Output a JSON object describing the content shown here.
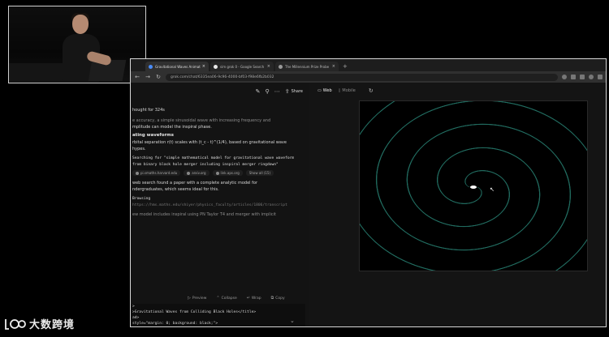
{
  "browser": {
    "tabs": [
      {
        "title": "Gravitational Waves Animatio",
        "active": true
      },
      {
        "title": "sim grok 0 - Google Search",
        "active": false
      },
      {
        "title": "The Millennium Prize Probe",
        "active": false
      }
    ],
    "new_tab": "+",
    "url": "grok.com/chat/6335ea06-9c96-4000-bf03-f98e6fb2b032",
    "nav": {
      "back": "←",
      "forward": "→",
      "reload": "↻"
    }
  },
  "chat": {
    "toolbar": {
      "share_label": "Share"
    },
    "lines": [
      {
        "kind": "bright",
        "text": "hought for 324s"
      },
      {
        "kind": "dim",
        "text": "e accuracy, a simple sinusoidal wave with increasing frequency and"
      },
      {
        "kind": "bright",
        "text": "mplitude can model the inspiral phase."
      },
      {
        "kind": "heading",
        "text": "ating waveforms"
      },
      {
        "kind": "dim",
        "text": "rbital separation r(t) scales with (t_c - t)^(1/4), based on gravitational wave"
      },
      {
        "kind": "dim",
        "text": "hypes."
      },
      {
        "kind": "mono",
        "text": "Searching for \"simple mathematical model for gravitational wave waveform"
      },
      {
        "kind": "mono",
        "text": "from binary black hole merger including inspiral merger ringdown\""
      }
    ],
    "sources": [
      "pi.smaths.harvard.edu",
      "arxiv.org",
      "link.aps.org",
      "Show all (15)"
    ],
    "lines2": [
      {
        "kind": "bright",
        "text": "web search found a paper with a complete analytic model for"
      },
      {
        "kind": "bright",
        "text": "ndergraduates, which seems ideal for this."
      },
      {
        "kind": "mono",
        "text": "Browsing"
      },
      {
        "kind": "mono-dim",
        "text": "https://hms.maths.edu/shiyer/physics_faculty/articles/1806/transcript"
      },
      {
        "kind": "dim",
        "text": "ew model includes inspiral using PN Taylor T4 and merger with implicit"
      }
    ],
    "code_actions": [
      "Preview",
      "Collapse",
      "Wrap",
      "Copy"
    ],
    "code_lines": [
      ">",
      ">",
      ">Gravitational Waves from Colliding Black Holes</title>",
      "ad>",
      " style=\"margin: 0; background: black;\">",
      "vas id=\"myCanvas\" width=\"800\" height=\"600\" style=\"display: block;",
      "ipt>"
    ]
  },
  "preview": {
    "toggle": {
      "web_label": "Web",
      "mobile_label": "Mobile"
    }
  },
  "watermark": {
    "text": "大数跨境"
  }
}
